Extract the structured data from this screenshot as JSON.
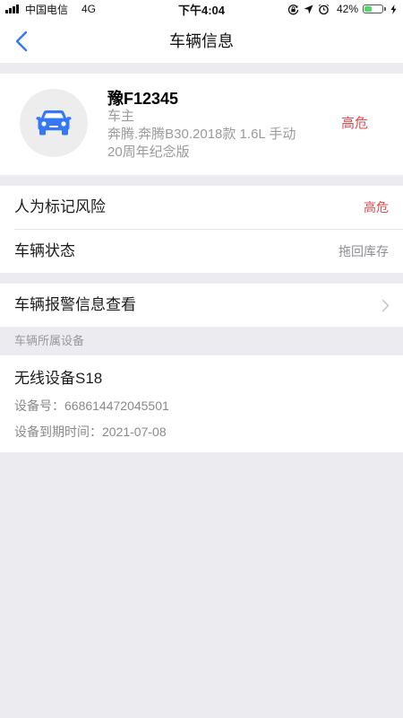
{
  "status_bar": {
    "carrier": "中国电信",
    "network": "4G",
    "time": "下午4:04",
    "battery": "42%"
  },
  "nav": {
    "title": "车辆信息",
    "back_icon": "chevron-left-icon"
  },
  "vehicle": {
    "plate": "豫F12345",
    "owner_label": "车主",
    "model_line1": "奔腾.奔腾B30.2018款 1.6L 手动",
    "model_line2": "20周年纪念版",
    "risk_level": "高危",
    "avatar_icon": "car-icon"
  },
  "info_rows": [
    {
      "label": "人为标记风险",
      "value": "高危",
      "color": "#e04a4f"
    },
    {
      "label": "车辆状态",
      "value": "拖回库存",
      "color": "#8e8e93"
    }
  ],
  "alarm_row": {
    "label": "车辆报警信息查看",
    "icon": "chevron-right-icon"
  },
  "device_section": {
    "header": "车辆所属设备",
    "devices": [
      {
        "name": "无线设备S18",
        "id_label": "设备号：",
        "id_value": "668614472045501",
        "expiry_label": "设备到期时间：",
        "expiry_value": "2021-07-08"
      }
    ]
  },
  "colors": {
    "accent": "#3478f6",
    "danger": "#e04a4f",
    "background": "#ebebf0",
    "battery": "#4cd964"
  }
}
